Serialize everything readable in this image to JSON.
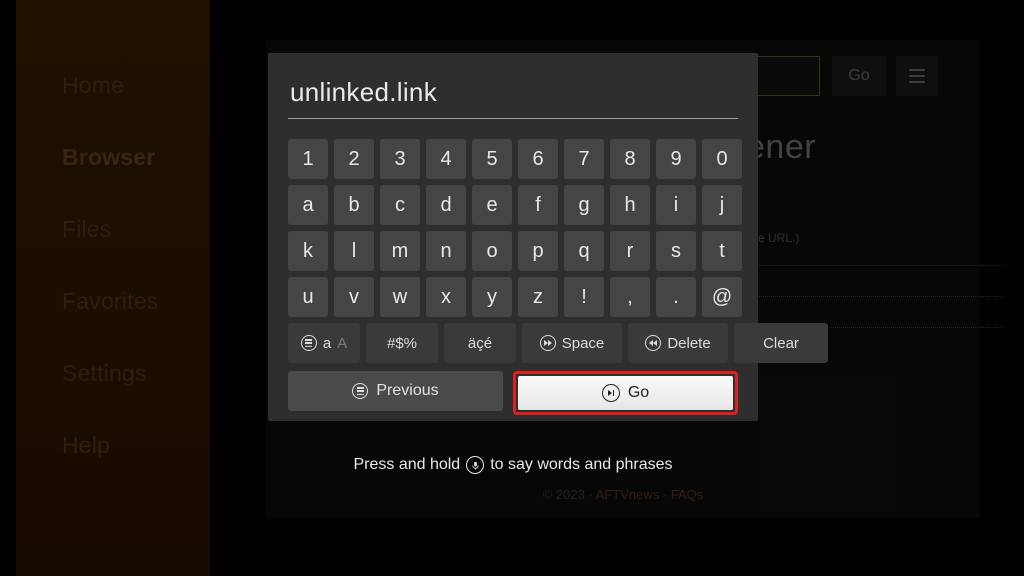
{
  "sidebar": {
    "items": [
      {
        "label": "Home"
      },
      {
        "label": "Browser"
      },
      {
        "label": "Files"
      },
      {
        "label": "Favorites"
      },
      {
        "label": "Settings"
      },
      {
        "label": "Help"
      }
    ],
    "active_index": 1
  },
  "top_bar": {
    "go_label": "Go"
  },
  "page": {
    "title_partial_visible": "ener",
    "hint_visible": "e URL.)",
    "footer_prefix": "© 2023 · ",
    "footer_link1": "AFTVnews",
    "footer_sep": " · ",
    "footer_link2": "FAQs"
  },
  "keyboard": {
    "input_value": "unlinked.link",
    "rows": [
      [
        "1",
        "2",
        "3",
        "4",
        "5",
        "6",
        "7",
        "8",
        "9",
        "0"
      ],
      [
        "a",
        "b",
        "c",
        "d",
        "e",
        "f",
        "g",
        "h",
        "i",
        "j"
      ],
      [
        "k",
        "l",
        "m",
        "n",
        "o",
        "p",
        "q",
        "r",
        "s",
        "t"
      ],
      [
        "u",
        "v",
        "w",
        "x",
        "y",
        "z",
        "!",
        ",",
        ".",
        "@"
      ]
    ],
    "fn_keys": {
      "shift_label": "a",
      "shift_label_dim": "A",
      "symbols_label": "#$%",
      "accents_label": "äçé",
      "space_label": "Space",
      "delete_label": "Delete",
      "clear_label": "Clear"
    },
    "nav": {
      "previous_label": "Previous",
      "go_label": "Go"
    },
    "hint_prefix": "Press and hold",
    "hint_suffix": "to say words and phrases"
  }
}
